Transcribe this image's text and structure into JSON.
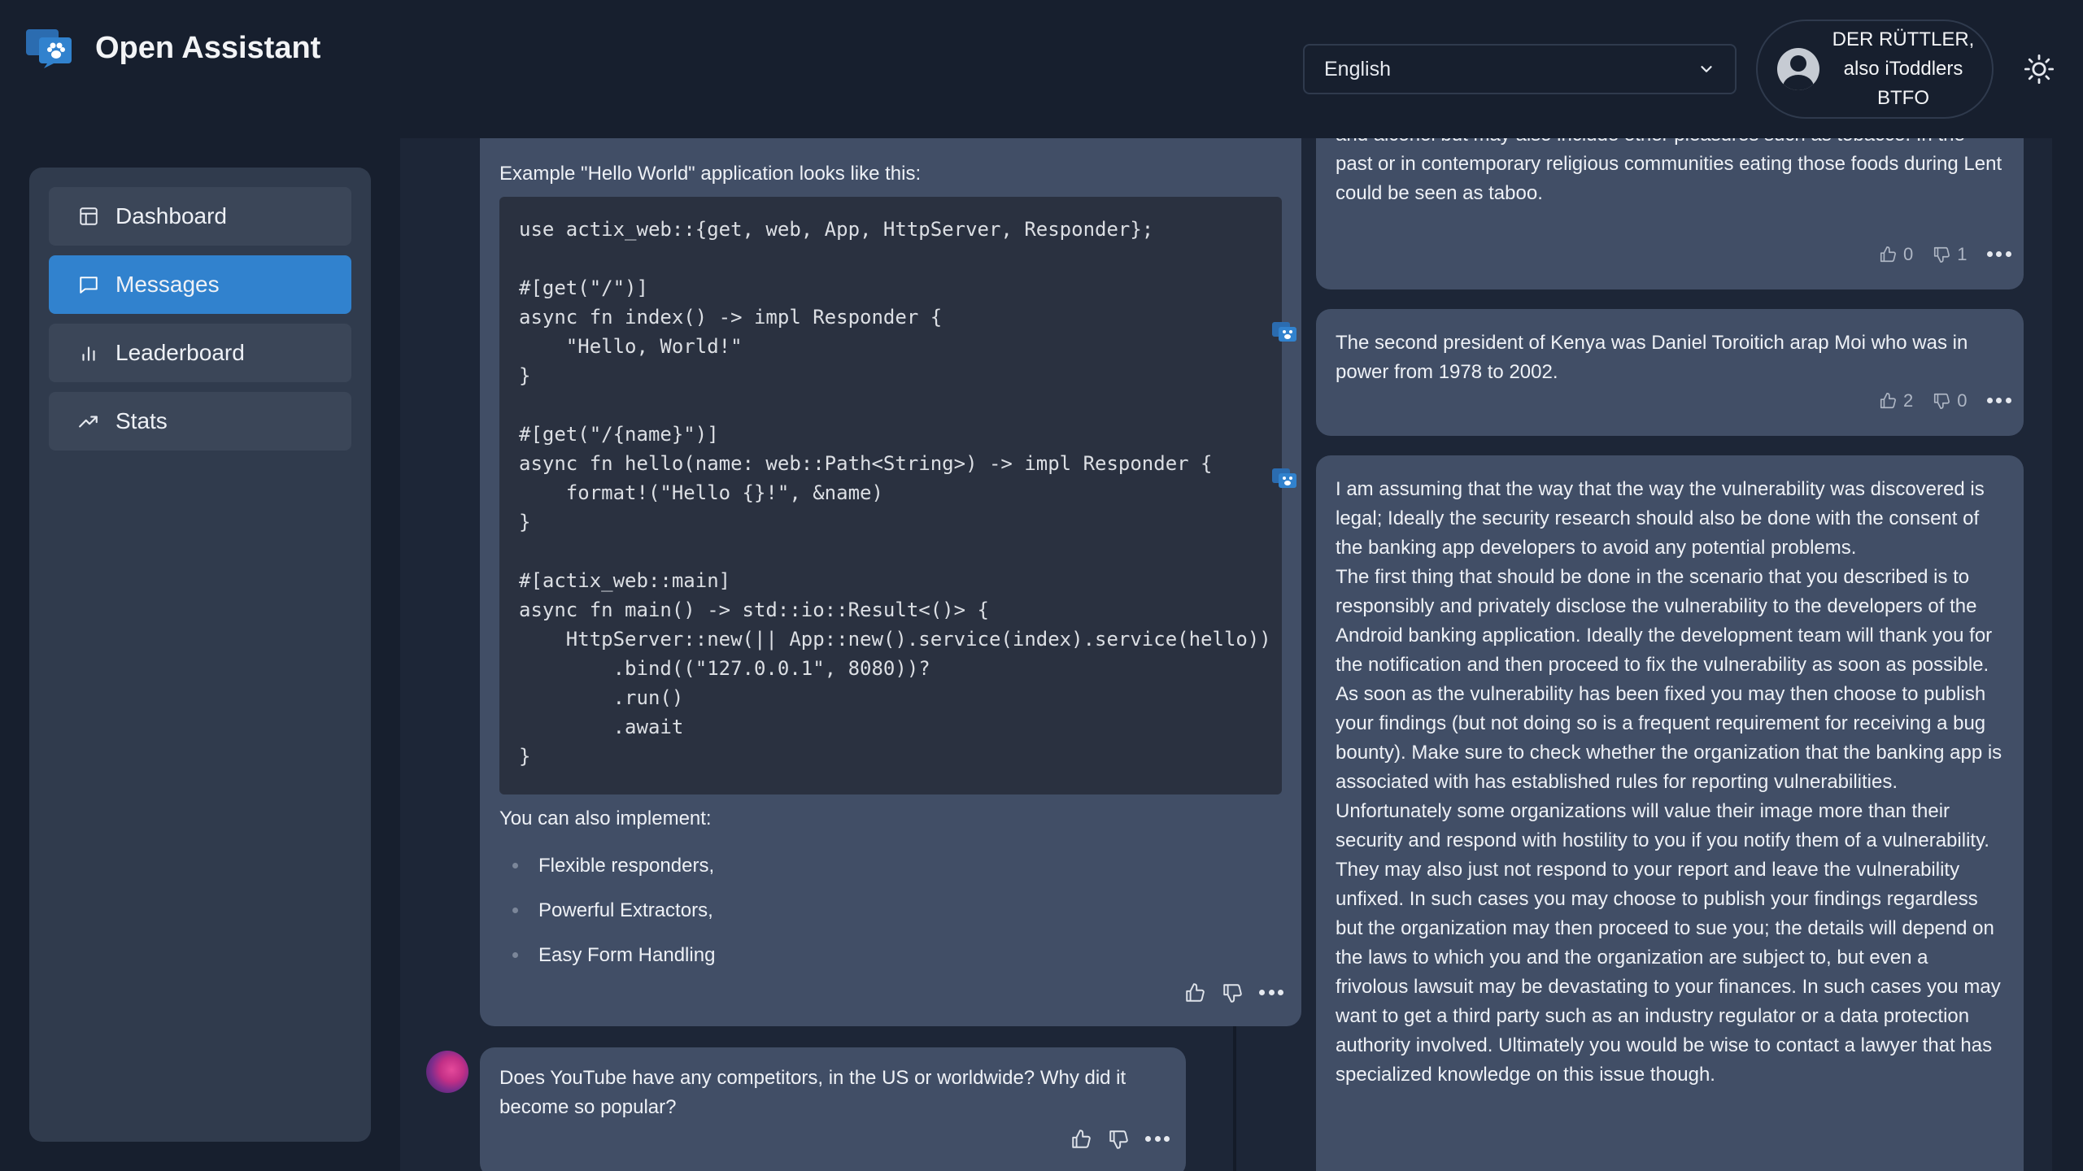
{
  "header": {
    "brand": "Open Assistant",
    "language": "English",
    "user_name": "DER RÜTTLER, also iToddlers BTFO"
  },
  "sidebar": {
    "items": [
      {
        "label": "Dashboard",
        "icon": "dashboard-icon",
        "active": false
      },
      {
        "label": "Messages",
        "icon": "messages-icon",
        "active": true
      },
      {
        "label": "Leaderboard",
        "icon": "leaderboard-icon",
        "active": false
      },
      {
        "label": "Stats",
        "icon": "stats-icon",
        "active": false
      }
    ]
  },
  "messages": {
    "code_message": {
      "intro": "Example \"Hello World\" application looks like this:",
      "code": "use actix_web::{get, web, App, HttpServer, Responder};\n\n#[get(\"/\")]\nasync fn index() -> impl Responder {\n    \"Hello, World!\"\n}\n\n#[get(\"/{name}\")]\nasync fn hello(name: web::Path<String>) -> impl Responder {\n    format!(\"Hello {}!\", &name)\n}\n\n#[actix_web::main]\nasync fn main() -> std::io::Result<()> {\n    HttpServer::new(|| App::new().service(index).service(hello))\n        .bind((\"127.0.0.1\", 8080))?\n        .run()\n        .await\n}",
      "outro": "You can also implement:",
      "bullets": [
        "Flexible responders,",
        "Powerful Extractors,",
        "Easy Form Handling"
      ]
    },
    "question": {
      "text": "Does YouTube have any competitors, in the US or worldwide? Why did it become so popular?"
    },
    "right": [
      {
        "text": "consume certain foods. These foods frequently include meat, dairy products, and alcohol but may also include other pleasures such as tobacco. In the past or in contemporary religious communities eating those foods during Lent could be seen as taboo.",
        "up": "0",
        "down": "1"
      },
      {
        "text": "The second president of Kenya was Daniel Toroitich arap Moi who was in power from 1978 to 2002.",
        "up": "2",
        "down": "0"
      },
      {
        "p1": "I am assuming that the way that the way the vulnerability was discovered is legal; Ideally the security research should also be done with the consent of the banking app developers to avoid any potential problems.",
        "p2": "The first thing that should be done in the scenario that you described is to responsibly and privately disclose the vulnerability to the developers of the Android banking application. Ideally the development team will thank you for the notification and then proceed to fix the vulnerability as soon as possible. As soon as the vulnerability has been fixed you may then choose to publish your findings (but not doing so is a frequent requirement for receiving a bug bounty). Make sure to check whether the organization that the banking app is associated with has established rules for reporting vulnerabilities.",
        "p3": "Unfortunately some organizations will value their image more than their security and respond with hostility to you if you notify them of a vulnerability. They may also just not respond to your report and leave the vulnerability unfixed. In such cases you may choose to publish your findings regardless but the organization may then proceed to sue you; the details will depend on the laws to which you and the organization are subject to, but even a frivolous lawsuit may be devastating to your finances. In such cases you may want to get a third party such as an industry regulator or a data protection authority involved. Ultimately you would be wise to contact a lawyer that has specialized knowledge on this issue though."
      }
    ]
  },
  "colors": {
    "background": "#171f2e",
    "card": "#414e66",
    "accent": "#3182ce"
  }
}
